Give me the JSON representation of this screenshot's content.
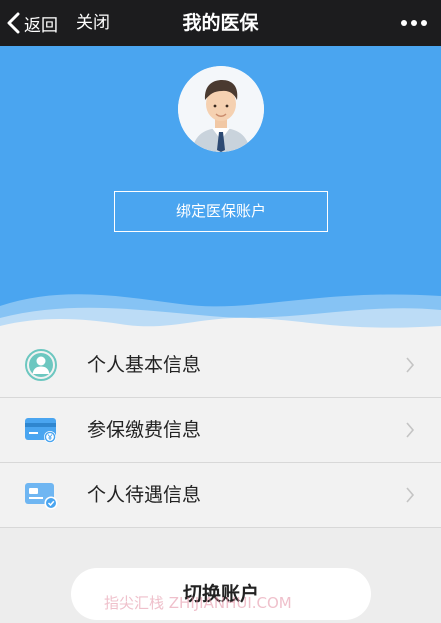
{
  "navbar": {
    "back_label": "返回",
    "close_label": "关闭",
    "title": "我的医保"
  },
  "hero": {
    "bind_button_label": "绑定医保账户"
  },
  "menu": {
    "items": [
      {
        "label": "个人基本信息",
        "icon": "person-icon"
      },
      {
        "label": "参保缴费信息",
        "icon": "payment-card-icon"
      },
      {
        "label": "个人待遇信息",
        "icon": "benefit-card-icon"
      }
    ]
  },
  "footer": {
    "switch_button_label": "切换账户"
  },
  "watermark": "指尖汇栈 ZHIJIANHUI.COM",
  "colors": {
    "navbar_bg": "#1c1c1e",
    "hero_blue": "#4aa5f0",
    "icon_teal": "#6cc7c0",
    "icon_blue": "#4aa5f0",
    "page_bg": "#ededed"
  }
}
